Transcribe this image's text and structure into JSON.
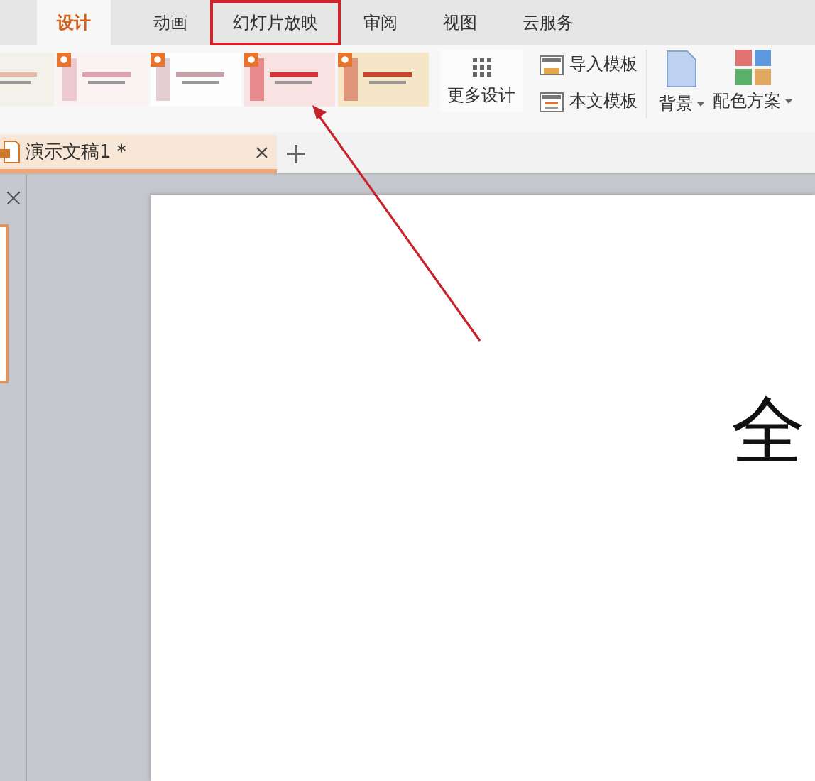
{
  "ribbon_tabs": [
    {
      "label": "设计",
      "selected": true,
      "highlighted": false
    },
    {
      "label": "动画",
      "selected": false,
      "highlighted": false
    },
    {
      "label": "幻灯片放映",
      "selected": false,
      "highlighted": true
    },
    {
      "label": "审阅",
      "selected": false,
      "highlighted": false
    },
    {
      "label": "视图",
      "selected": false,
      "highlighted": false
    },
    {
      "label": "云服务",
      "selected": false,
      "highlighted": false
    }
  ],
  "design_tools": {
    "more_designs": "更多设计",
    "import_template": "导入模板",
    "body_template": "本文模板",
    "background": "背景",
    "color_scheme": "配色方案"
  },
  "document_tabs": [
    {
      "title": "演示文稿1 *",
      "selected": true
    }
  ],
  "slide": {
    "text": "全"
  }
}
